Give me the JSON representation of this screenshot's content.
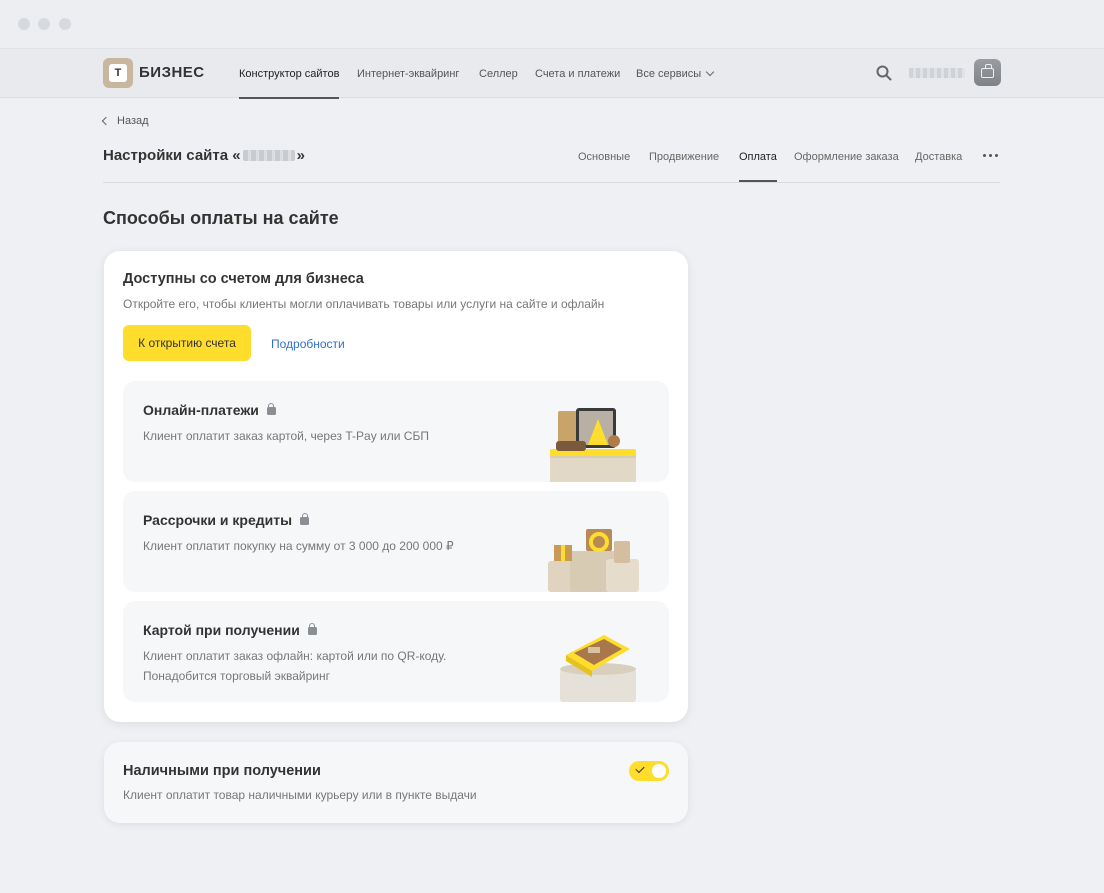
{
  "header": {
    "logo_mark": "Т",
    "logo_text": "БИЗНЕС",
    "nav": [
      {
        "label": "Конструктор сайтов",
        "active": true
      },
      {
        "label": "Интернет-эквайринг"
      },
      {
        "label": "Селлер"
      },
      {
        "label": "Счета и платежи"
      },
      {
        "label": "Все сервисы"
      }
    ]
  },
  "subheader": {
    "back_label": "Назад",
    "site_title_prefix": "Настройки сайта «",
    "site_title_suffix": "»",
    "tabs": [
      {
        "label": "Основные"
      },
      {
        "label": "Продвижение"
      },
      {
        "label": "Оплата",
        "active": true
      },
      {
        "label": "Оформление заказа"
      },
      {
        "label": "Доставка"
      }
    ]
  },
  "section_title": "Способы оплаты на сайте",
  "business_card": {
    "title": "Доступны со счетом для бизнеса",
    "subtitle": "Откройте его, чтобы клиенты могли оплачивать товары или услуги на сайте и офлайн",
    "open_button": "К открытию счета",
    "details_link": "Подробности",
    "items": [
      {
        "title": "Онлайн-платежи",
        "description": "Клиент оплатит заказ картой, через T-Pay или СБП"
      },
      {
        "title": "Рассрочки и кредиты",
        "description": "Клиент оплатит покупку на сумму от 3 000 до 200 000 ₽"
      },
      {
        "title": "Картой при получении",
        "description": "Клиент оплатит заказ офлайн: картой или по QR-коду. Понадобится торговый эквайринг"
      }
    ]
  },
  "cash": {
    "title": "Наличными при получении",
    "description": "Клиент оплатит товар наличными курьеру или в пункте выдачи",
    "enabled": true
  },
  "colors": {
    "accent_yellow": "#ffdd2d",
    "link_blue": "#2f6fcf"
  }
}
